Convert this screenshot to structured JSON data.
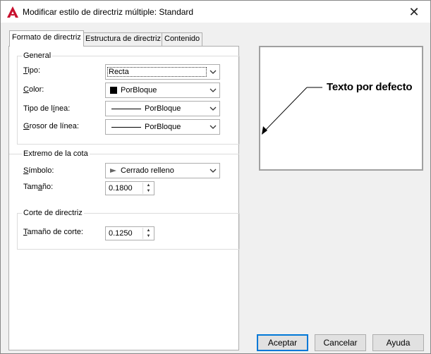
{
  "window": {
    "title": "Modificar estilo de directriz múltiple: Standard",
    "close_symbol": "✕"
  },
  "tabs": [
    {
      "label": "Formato de directriz",
      "active": true
    },
    {
      "label": "Estructura de directriz",
      "active": false
    },
    {
      "label": "Contenido",
      "active": false
    }
  ],
  "general": {
    "title": "General",
    "tipo": {
      "mnemonic": "T",
      "rest": "ipo:",
      "value": "Recta"
    },
    "color": {
      "mnemonic": "C",
      "rest": "olor:",
      "value": "PorBloque"
    },
    "tipo_linea": {
      "label_a": "Tipo de l",
      "mnemonic": "í",
      "label_b": "nea:",
      "value": "PorBloque"
    },
    "grosor": {
      "mnemonic": "G",
      "rest": "rosor de línea:",
      "value": "PorBloque"
    }
  },
  "extremo": {
    "title": "Extremo de la cota",
    "simbolo": {
      "mnemonic": "S",
      "rest": "ímbolo:",
      "value": "Cerrado relleno",
      "icon": "arrow-icon"
    },
    "tamano": {
      "label_a": "Tam",
      "mnemonic": "a",
      "label_b": "ño:",
      "value": "0.1800"
    }
  },
  "corte": {
    "title": "Corte de directriz",
    "tamano_corte": {
      "mnemonic": "T",
      "rest": "amaño de corte:",
      "value": "0.1250"
    }
  },
  "preview": {
    "text": "Texto por defecto"
  },
  "buttons": {
    "ok": "Aceptar",
    "cancel": "Cancelar",
    "help": "Ayuda"
  },
  "colors": {
    "accent": "#0078d7",
    "app_icon": "#c8102e"
  }
}
